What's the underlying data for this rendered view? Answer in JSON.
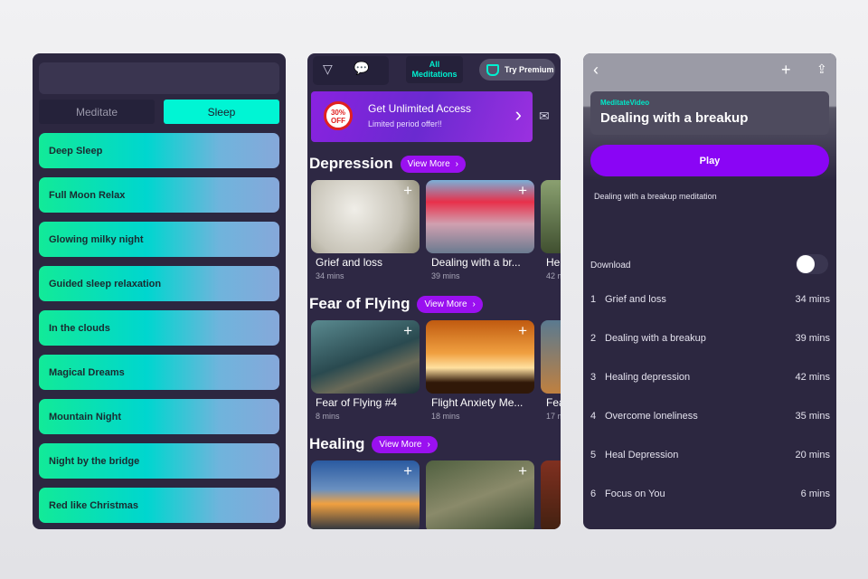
{
  "sleep_panel": {
    "tabs": [
      "Meditate",
      "Sleep"
    ],
    "active_tab": "Sleep",
    "items": [
      "Deep Sleep",
      "Full Moon Relax",
      "Glowing milky night",
      "Guided sleep relaxation",
      "In the clouds",
      "Magical Dreams",
      "Mountain Night",
      "Night by the bridge",
      "Red like Christmas"
    ]
  },
  "browse_panel": {
    "all_meditations": "All Meditations",
    "try_premium": "Try Premium",
    "banner": {
      "badge": "30% OFF",
      "title": "Get Unlimited Access",
      "subtitle": "Limited period offer!!"
    },
    "view_more": "View More",
    "sections": [
      {
        "title": "Depression",
        "cards": [
          {
            "title": "Grief and loss",
            "duration": "34 mins"
          },
          {
            "title": "Dealing with a br...",
            "duration": "39 mins"
          },
          {
            "title": "He",
            "duration": "42 m"
          }
        ]
      },
      {
        "title": "Fear of Flying",
        "cards": [
          {
            "title": "Fear of Flying #4",
            "duration": "8 mins"
          },
          {
            "title": "Flight Anxiety Me...",
            "duration": "18 mins"
          },
          {
            "title": "Fea",
            "duration": "17 m"
          }
        ]
      },
      {
        "title": "Healing",
        "cards": []
      }
    ]
  },
  "detail_panel": {
    "category": "MeditateVideo",
    "title": "Dealing with a breakup",
    "play": "Play",
    "description": "Dealing with a breakup meditation",
    "download": "Download",
    "download_enabled": false,
    "tracks": [
      {
        "n": "1",
        "title": "Grief and loss",
        "duration": "34 mins"
      },
      {
        "n": "2",
        "title": "Dealing with a breakup",
        "duration": "39 mins"
      },
      {
        "n": "3",
        "title": "Healing depression",
        "duration": "42 mins"
      },
      {
        "n": "4",
        "title": "Overcome loneliness",
        "duration": "35 mins"
      },
      {
        "n": "5",
        "title": "Heal Depression",
        "duration": "20 mins"
      },
      {
        "n": "6",
        "title": "Focus on You",
        "duration": "6 mins"
      }
    ]
  }
}
